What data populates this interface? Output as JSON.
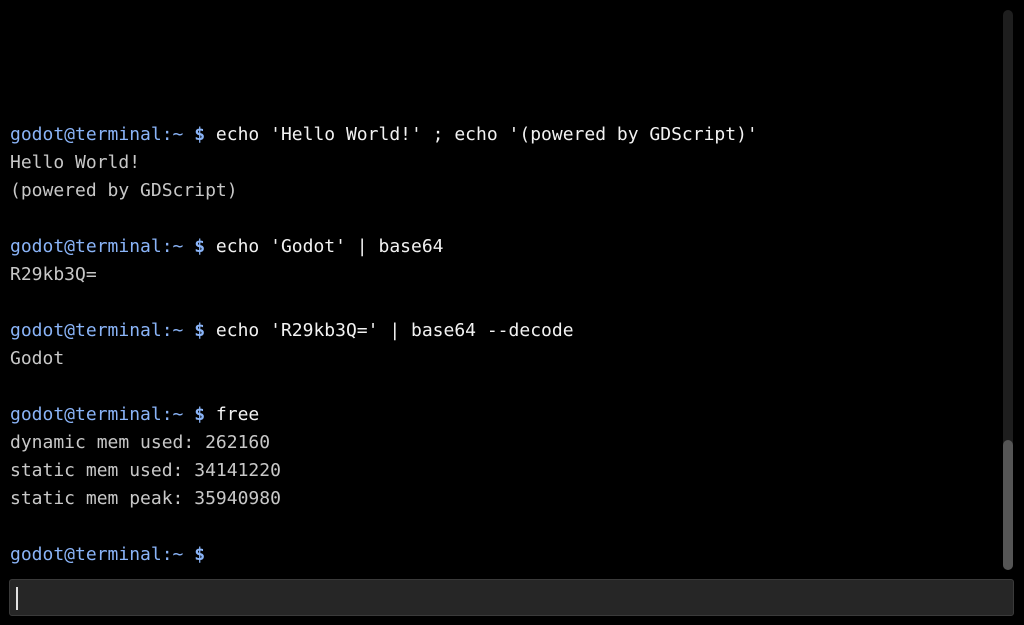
{
  "colors": {
    "background": "#000000",
    "prompt": "#8ab4f8",
    "command_text": "#f2f2f2",
    "output_text": "#c8c8c8",
    "input_background": "#262626",
    "scrollbar_thumb": "#555555"
  },
  "terminal": {
    "entries": [
      {
        "prompt_user": "godot@terminal:~",
        "prompt_symbol": "$",
        "command": "echo 'Hello World!' ; echo '(powered by GDScript)'",
        "output": [
          "Hello World!",
          "(powered by GDScript)"
        ]
      },
      {
        "prompt_user": "godot@terminal:~",
        "prompt_symbol": "$",
        "command": "echo 'Godot' | base64",
        "output": [
          "R29kb3Q="
        ]
      },
      {
        "prompt_user": "godot@terminal:~",
        "prompt_symbol": "$",
        "command": "echo 'R29kb3Q=' | base64 --decode",
        "output": [
          "Godot"
        ]
      },
      {
        "prompt_user": "godot@terminal:~",
        "prompt_symbol": "$",
        "command": "free",
        "output": [
          "dynamic mem used: 262160",
          "static mem used: 34141220",
          "static mem peak: 35940980"
        ]
      }
    ],
    "current_prompt": {
      "prompt_user": "godot@terminal:~",
      "prompt_symbol": "$"
    }
  },
  "command_input": {
    "value": "",
    "placeholder": ""
  }
}
